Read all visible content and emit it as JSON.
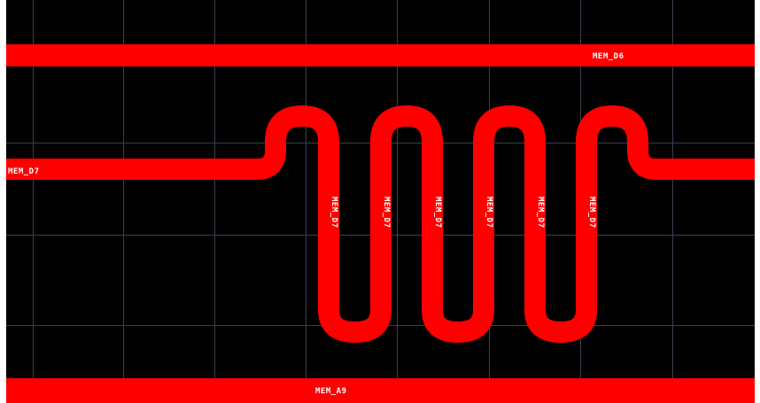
{
  "colors": {
    "background": "#000000",
    "grid": "#3a4050",
    "trace": "#ff0000",
    "label": "#ffffff"
  },
  "nets": {
    "top": "MEM_D6",
    "serpentine": "MEM_D7",
    "bottom": "MEM_A9"
  },
  "serpentine_labels": [
    "MEM_D7",
    "MEM_D7",
    "MEM_D7",
    "MEM_D7",
    "MEM_D7",
    "MEM_D7"
  ]
}
